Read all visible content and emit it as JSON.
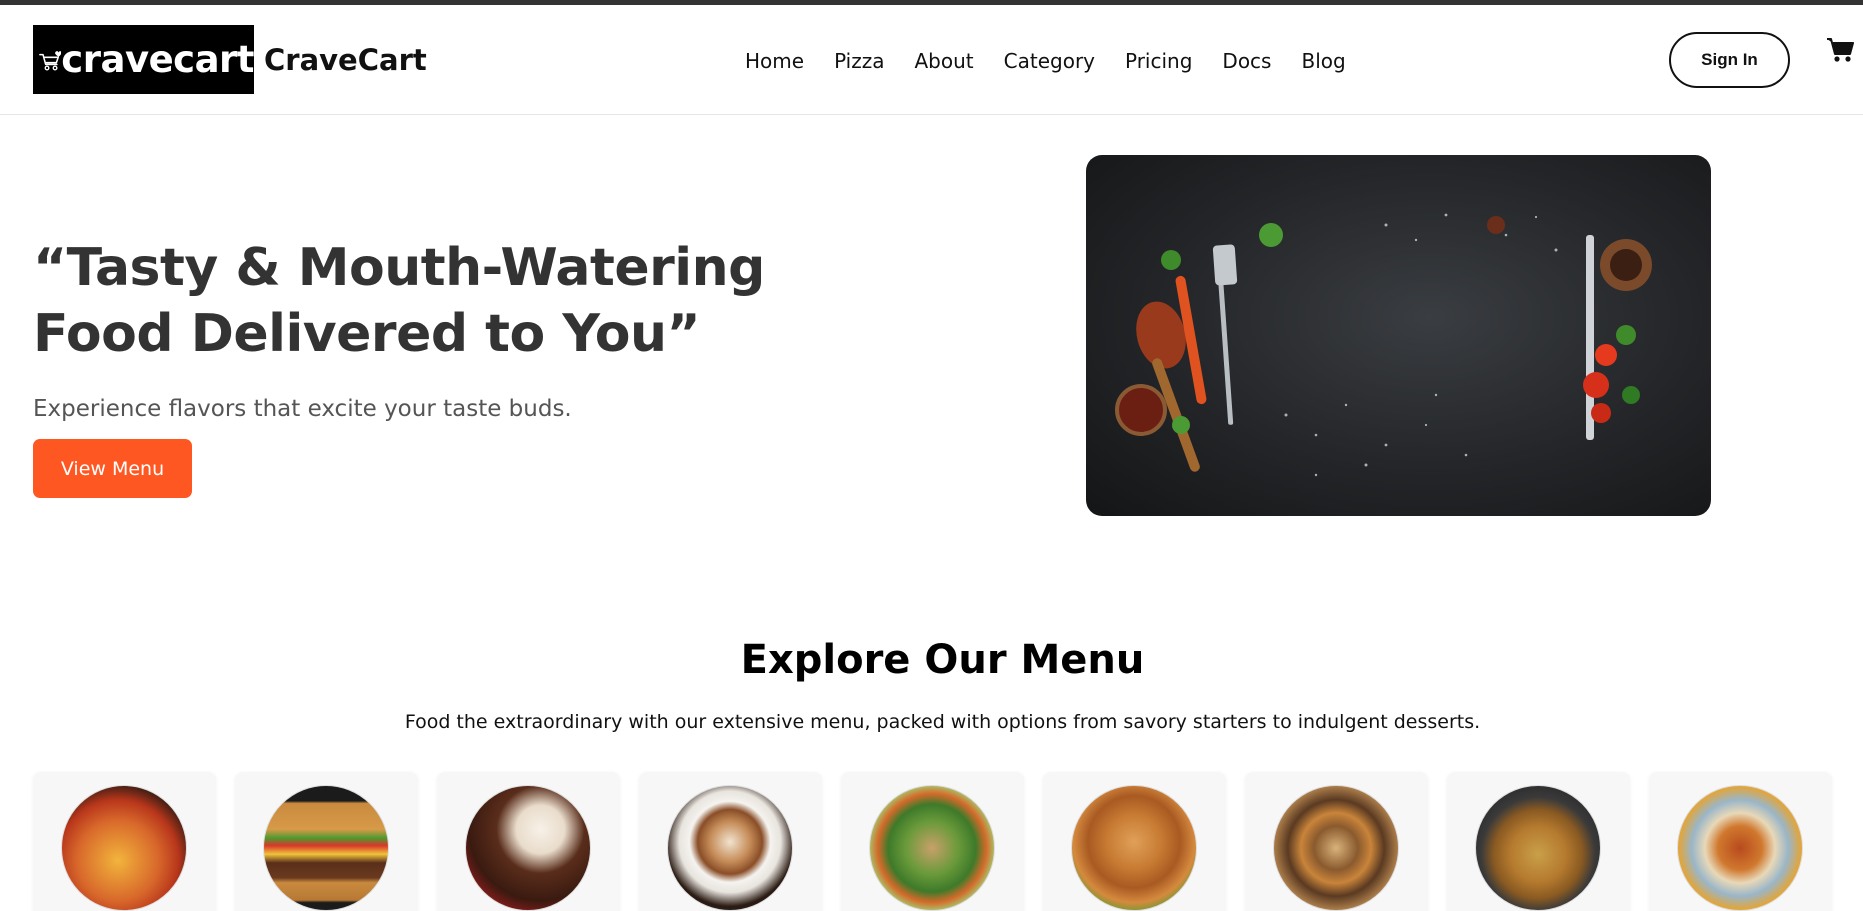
{
  "brand": {
    "logo_text": "cravecart",
    "name": "CraveCart"
  },
  "nav": {
    "items": [
      "Home",
      "Pizza",
      "About",
      "Category",
      "Pricing",
      "Docs",
      "Blog"
    ]
  },
  "header": {
    "signin_label": "Sign In",
    "cart_icon": "shopping-cart-icon"
  },
  "hero": {
    "title": "“Tasty & Mouth-Watering Food Delivered to You”",
    "subtitle": "Experience flavors that excite your taste buds.",
    "cta_label": "View Menu",
    "cta_color": "#ff5722"
  },
  "menu": {
    "title": "Explore Our Menu",
    "subtitle": "Food the extraordinary with our extensive menu, packed with options from savory starters to indulgent desserts."
  },
  "colors": {
    "accent": "#ff5722",
    "text_dark": "#333333"
  }
}
